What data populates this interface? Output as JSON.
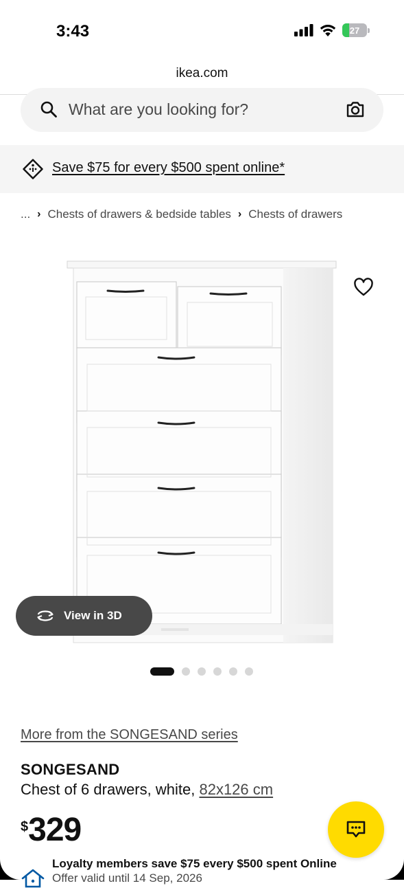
{
  "status_bar": {
    "time": "3:43",
    "battery": "27"
  },
  "browser": {
    "url": "ikea.com"
  },
  "search": {
    "placeholder": "What are you looking for?"
  },
  "promo": {
    "text": "Save $75 for every $500 spent online*"
  },
  "breadcrumb": {
    "ellipsis": "...",
    "items": [
      "Chests of drawers & bedside tables",
      "Chests of drawers"
    ]
  },
  "gallery": {
    "view3d_label": "View in 3D",
    "image_count": 6,
    "active_index": 0
  },
  "product": {
    "series_link": "More from the SONGESAND series",
    "name": "SONGESAND",
    "description": "Chest of 6 drawers, white,",
    "size": "82x126 cm",
    "currency": "$",
    "price": "329"
  },
  "loyalty": {
    "title": "Loyalty members save $75 every $500 spent Online",
    "subtitle": "Offer valid until 14 Sep, 2026"
  },
  "colors": {
    "accent_yellow": "#ffdb00",
    "dark_grey": "#484848",
    "battery_green": "#34c759"
  }
}
